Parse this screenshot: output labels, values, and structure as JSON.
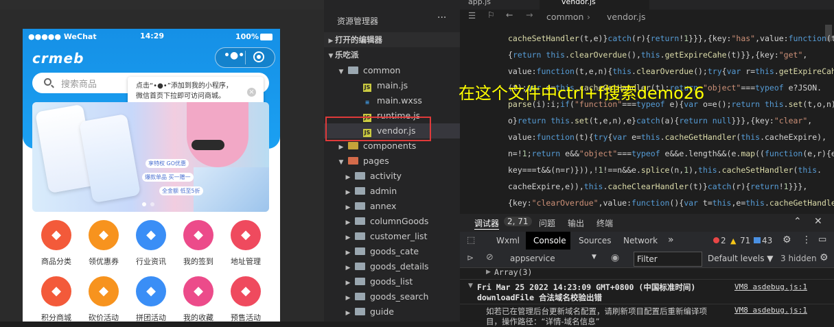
{
  "simulator": {
    "status": {
      "carrier": "●●●●● WeChat",
      "time": "14:29",
      "battery": "100%"
    },
    "logo": "crmeb",
    "search_placeholder": "搜索商品",
    "tooltip": {
      "line1": "点击“•●•”添加到我的小程序，",
      "line2": "微信首页下拉即可访问商城。"
    },
    "banner_captions": [
      "享特权 GO优惠",
      "爆款单品 买一赠一",
      "全金额 低至5折"
    ],
    "categories": [
      {
        "label": "商品分类",
        "icon": "shopping-bag-icon",
        "color": "#f35a3a"
      },
      {
        "label": "领优惠券",
        "icon": "coupon-icon",
        "color": "#f7931e"
      },
      {
        "label": "行业资讯",
        "icon": "news-icon",
        "color": "#3a8ef6"
      },
      {
        "label": "我的签到",
        "icon": "calendar-icon",
        "color": "#ec4b8a"
      },
      {
        "label": "地址管理",
        "icon": "location-icon",
        "color": "#ef4a5e"
      },
      {
        "label": "积分商城",
        "icon": "gift-icon",
        "color": "#f35a3a"
      },
      {
        "label": "砍价活动",
        "icon": "percent-icon",
        "color": "#f7931e"
      },
      {
        "label": "拼团活动",
        "icon": "megaphone-icon",
        "color": "#3a8ef6"
      },
      {
        "label": "我的收藏",
        "icon": "star-icon",
        "color": "#ec4b8a"
      },
      {
        "label": "预售活动",
        "icon": "calendar-icon",
        "color": "#ef4a5e"
      }
    ]
  },
  "explorer": {
    "title": "资源管理器",
    "more": "···",
    "sections": [
      "打开的编辑器",
      "乐吃派"
    ],
    "tree": [
      {
        "label": "common",
        "type": "folder"
      },
      {
        "label": "main.js",
        "type": "js"
      },
      {
        "label": "main.wxss",
        "type": "css"
      },
      {
        "label": "runtime.js",
        "type": "js"
      },
      {
        "label": "vendor.js",
        "type": "js"
      },
      {
        "label": "components",
        "type": "folder"
      },
      {
        "label": "pages",
        "type": "folder"
      },
      {
        "label": "activity",
        "type": "folder"
      },
      {
        "label": "admin",
        "type": "folder"
      },
      {
        "label": "annex",
        "type": "folder"
      },
      {
        "label": "columnGoods",
        "type": "folder"
      },
      {
        "label": "customer_list",
        "type": "folder"
      },
      {
        "label": "goods_cate",
        "type": "folder"
      },
      {
        "label": "goods_details",
        "type": "folder"
      },
      {
        "label": "goods_list",
        "type": "folder"
      },
      {
        "label": "goods_search",
        "type": "folder"
      },
      {
        "label": "guide",
        "type": "folder"
      }
    ]
  },
  "editor": {
    "tabs": [
      "app.js",
      "vendor.js"
    ],
    "breadcrumb": [
      "common",
      "vendor.js"
    ],
    "annotation": "在这个文件中ctrl+f搜索demo26"
  },
  "debugger": {
    "tabs": [
      "调试器",
      "问题",
      "输出",
      "终端"
    ],
    "badge": "2, 71",
    "panel_tabs": [
      "Wxml",
      "Console",
      "Sources",
      "Network"
    ],
    "counts": {
      "errors": "2",
      "warnings": "71",
      "info": "43"
    },
    "context": "appservice",
    "filter_placeholder": "Filter",
    "levels": "Default levels ▼",
    "hidden": "3 hidden",
    "log_array": "Array(3)",
    "log_time": "Fri Mar 25 2022 14:23:09 GMT+0800 (中国标准时间)",
    "log_title": "downloadFile 合法域名校验出错",
    "log_body1": "如若已在管理后台更新域名配置，请刷新项目配置后重新编译项",
    "log_body2": "目，操作路径：“详情-域名信息”",
    "source1": "VM8 asdebug.js:1",
    "source2": "VM8 asdebug.js:1"
  }
}
